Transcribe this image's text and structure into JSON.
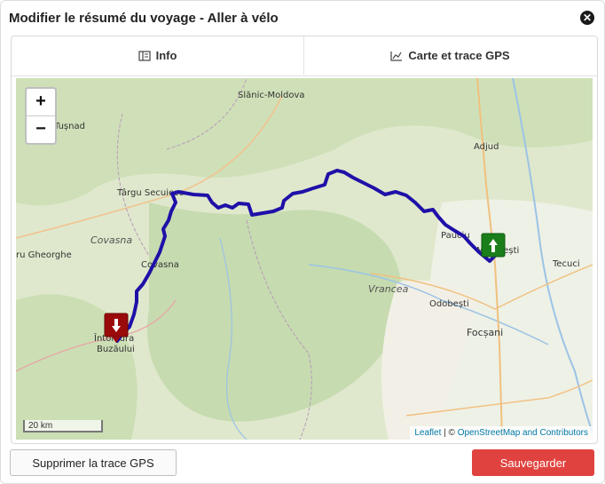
{
  "dialog": {
    "title": "Modifier le résumé du voyage - Aller à vélo"
  },
  "tabs": [
    {
      "label": "Info"
    },
    {
      "label": "Carte et trace GPS"
    }
  ],
  "map": {
    "zoom_in": "+",
    "zoom_out": "−",
    "scale": "20 km",
    "attribution_leaflet": "Leaflet",
    "attribution_sep": " | © ",
    "attribution_osm": "OpenStreetMap and Contributors",
    "places": {
      "slanic": "Slănic-Moldova",
      "tusnad": "Tușnad",
      "adjud": "Adjud",
      "targu": "Târgu Secuiesc",
      "covasna_county": "Covasna",
      "gheorghe": "ru Gheorghe",
      "covasna": "Covasna",
      "paunciu": "Pauciu",
      "marasesti": "Mărășești",
      "tecuci": "Tecuci",
      "vrancea": "Vrancea",
      "odobesti": "Odobești",
      "focsani": "Focșani",
      "intorsura1": "Întorsura",
      "intorsura2": "Buzăului"
    },
    "colors": {
      "track": "#1f10a8",
      "start_marker": "#1a7f1a",
      "end_marker": "#9b0a0a"
    }
  },
  "actions": {
    "delete_label": "Supprimer la trace GPS",
    "save_label": "Sauvegarder"
  }
}
